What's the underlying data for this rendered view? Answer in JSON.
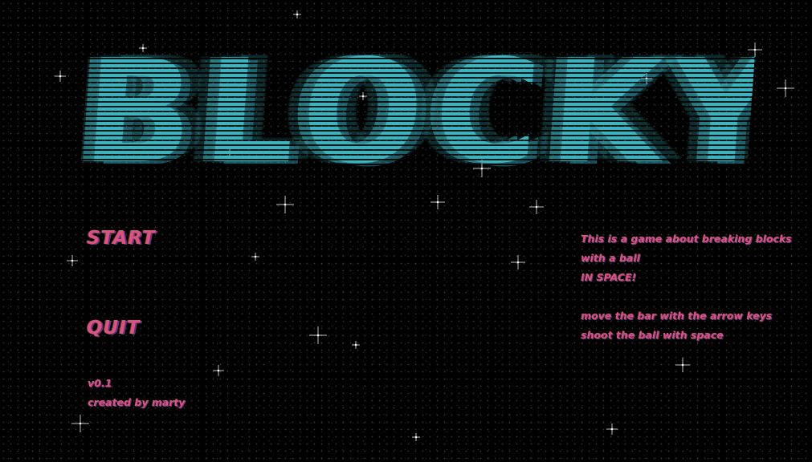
{
  "title": "BLOCKY",
  "menu": {
    "start_label": "START",
    "quit_label": "QUIT"
  },
  "footer": {
    "version": "v0.1",
    "credit": "created by marty"
  },
  "info": {
    "line1": "This is a game about breaking blocks",
    "line2": "with a ball",
    "line3": "IN SPACE!",
    "line4": "move the bar with the arrow keys",
    "line5": "shoot the ball with space"
  },
  "colors": {
    "background": "#000000",
    "title": "#3fb3bd",
    "text": "#d9557d"
  }
}
